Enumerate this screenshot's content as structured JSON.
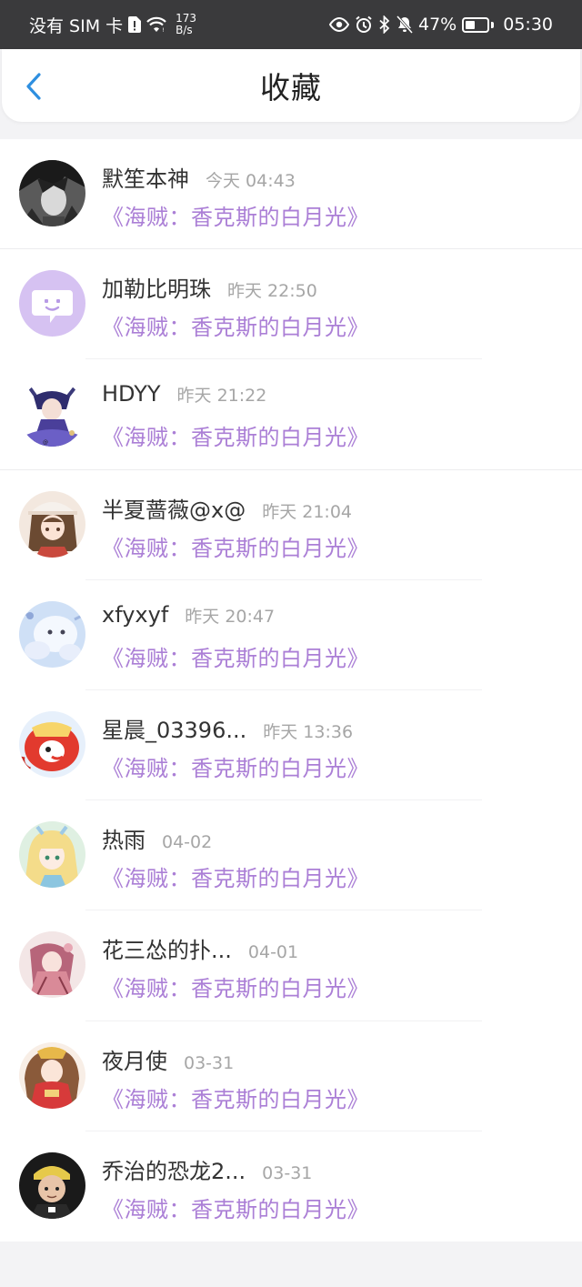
{
  "status_bar": {
    "carrier": "没有 SIM 卡",
    "speed_value": "173",
    "speed_unit": "B/s",
    "battery": "47%",
    "battery_level": 0.47,
    "time": "05:30"
  },
  "header": {
    "title": "收藏"
  },
  "favorites": [
    {
      "name": "默笙本神",
      "time": "今天 04:43",
      "title": "《海贼：香克斯的白月光》",
      "avatar": "dark-anime-avatar"
    },
    {
      "name": "加勒比明珠",
      "time": "昨天 22:50",
      "title": "《海贼：香克斯的白月光》",
      "avatar": "purple-chat-avatar"
    },
    {
      "name": "HDYY",
      "time": "昨天 21:22",
      "title": "《海贼：香克斯的白月光》",
      "avatar": "anime-girl-blue-avatar"
    },
    {
      "name": "半夏蔷薇@x@",
      "time": "昨天 21:04",
      "title": "《海贼：香克斯的白月光》",
      "avatar": "anime-girl-hat-avatar"
    },
    {
      "name": "xfyxyf",
      "time": "昨天 20:47",
      "title": "《海贼：香克斯的白月光》",
      "avatar": "snow-creature-avatar"
    },
    {
      "name": "星晨_03396...",
      "time": "昨天 13:36",
      "title": "《海贼：香克斯的白月光》",
      "avatar": "red-cartoon-avatar"
    },
    {
      "name": "热雨",
      "time": "04-02",
      "title": "《海贼：香克斯的白月光》",
      "avatar": "blonde-anime-avatar"
    },
    {
      "name": "花三怂的扑...",
      "time": "04-01",
      "title": "《海贼：香克斯的白月光》",
      "avatar": "pink-anime-avatar"
    },
    {
      "name": "夜月使",
      "time": "03-31",
      "title": "《海贼：香克斯的白月光》",
      "avatar": "red-dress-anime-avatar"
    },
    {
      "name": "乔治的恐龙2...",
      "time": "03-31",
      "title": "《海贼：香克斯的白月光》",
      "avatar": "child-yellow-hat-avatar"
    }
  ],
  "colors": {
    "accent": "#2e8fe0",
    "title_purple": "#ab7fd6",
    "status_bar": "#3a3a3c"
  }
}
